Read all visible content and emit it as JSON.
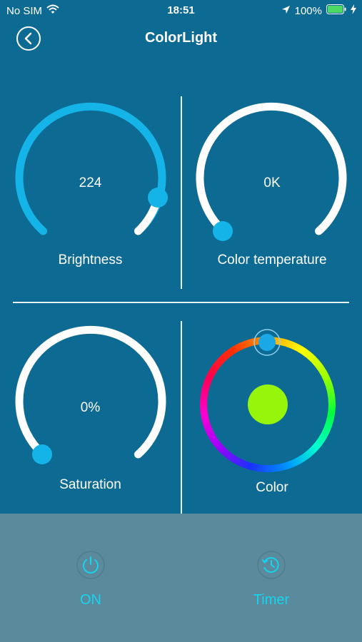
{
  "status_bar": {
    "carrier": "No SIM",
    "time": "18:51",
    "battery": "100%"
  },
  "nav": {
    "title": "ColorLight",
    "back_icon": "chevron-left-icon"
  },
  "dials": {
    "brightness": {
      "value": "224",
      "label": "Brightness"
    },
    "color_temperature": {
      "value": "0K",
      "label": "Color temperature"
    },
    "saturation": {
      "value": "0%",
      "label": "Saturation"
    },
    "color": {
      "label": "Color",
      "swatch_color": "#96f50a"
    }
  },
  "bottom": {
    "on": {
      "label": "ON",
      "icon": "power-icon"
    },
    "timer": {
      "label": "Timer",
      "icon": "clock-icon"
    }
  },
  "colors": {
    "background": "#0d6a93",
    "bottom_bar": "#5a8a9b",
    "accent": "#14b4e8",
    "bottom_text": "#14d4ef",
    "battery": "#4cd964"
  }
}
